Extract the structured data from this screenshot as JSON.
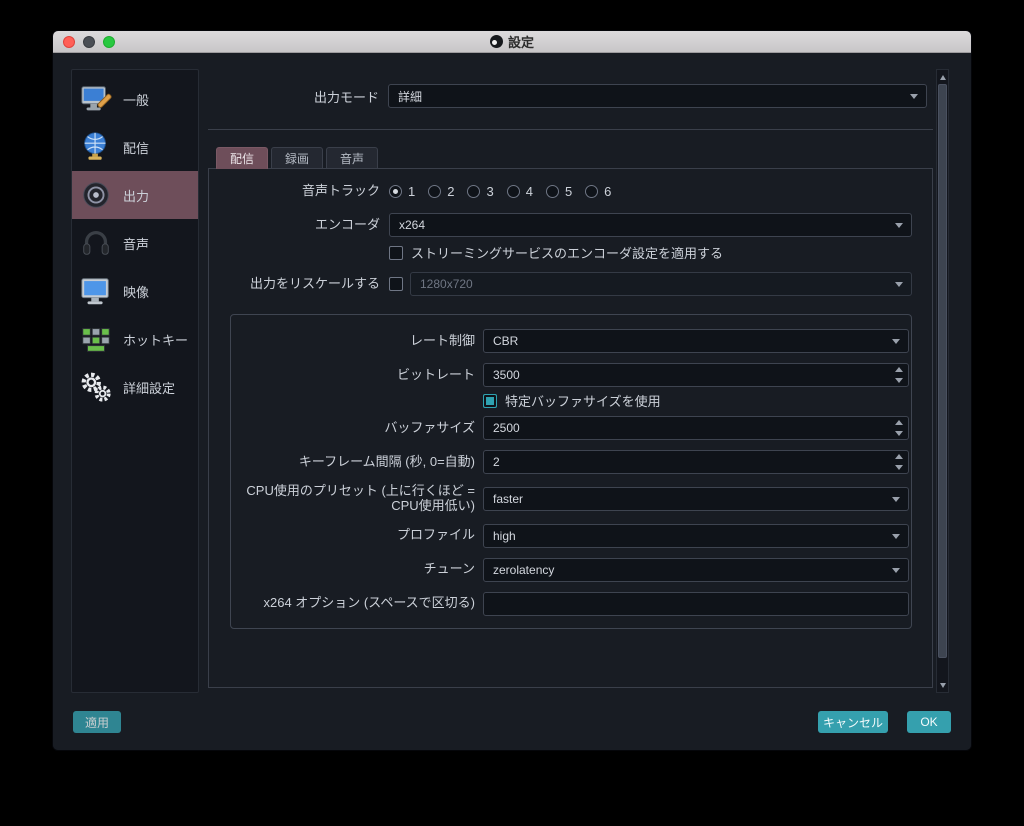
{
  "window": {
    "title": "設定"
  },
  "sidebar": {
    "items": [
      {
        "label": "一般",
        "icon": "general-display-icon"
      },
      {
        "label": "配信",
        "icon": "stream-globe-icon"
      },
      {
        "label": "出力",
        "icon": "output-broadcast-icon"
      },
      {
        "label": "音声",
        "icon": "audio-headphones-icon"
      },
      {
        "label": "映像",
        "icon": "video-monitor-icon"
      },
      {
        "label": "ホットキー",
        "icon": "hotkeys-keyboard-icon"
      },
      {
        "label": "詳細設定",
        "icon": "advanced-gears-icon"
      }
    ],
    "selected": "出力"
  },
  "output_mode": {
    "label": "出力モード",
    "value": "詳細"
  },
  "tabs": [
    {
      "label": "配信"
    },
    {
      "label": "録画"
    },
    {
      "label": "音声"
    }
  ],
  "selected_tab": "配信",
  "stream": {
    "audio_track": {
      "label": "音声トラック",
      "options": [
        "1",
        "2",
        "3",
        "4",
        "5",
        "6"
      ],
      "selected": "1"
    },
    "encoder": {
      "label": "エンコーダ",
      "value": "x264"
    },
    "enforce_service": {
      "label": "ストリーミングサービスのエンコーダ設定を適用する",
      "checked": false
    },
    "rescale": {
      "label": "出力をリスケールする",
      "checked": false,
      "value": "1280x720"
    },
    "encoder_settings": {
      "rate_control": {
        "label": "レート制御",
        "value": "CBR"
      },
      "bitrate": {
        "label": "ビットレート",
        "value": "3500"
      },
      "custom_buffer": {
        "label": "特定バッファサイズを使用",
        "checked": true
      },
      "buffer_size": {
        "label": "バッファサイズ",
        "value": "2500"
      },
      "keyframe_interval": {
        "label": "キーフレーム間隔 (秒, 0=自動)",
        "value": "2"
      },
      "cpu_preset": {
        "label": "CPU使用のプリセット (上に行くほど = CPU使用低い)",
        "value": "faster"
      },
      "profile": {
        "label": "プロファイル",
        "value": "high"
      },
      "tune": {
        "label": "チューン",
        "value": "zerolatency"
      },
      "x264_options": {
        "label": "x264 オプション (スペースで区切る)",
        "value": ""
      }
    }
  },
  "footer": {
    "apply": "適用",
    "cancel": "キャンセル",
    "ok": "OK"
  },
  "colors": {
    "accent_teal": "#35a0ae",
    "selection_mauve": "#6e4e5a",
    "panel_bg": "#181c23"
  }
}
